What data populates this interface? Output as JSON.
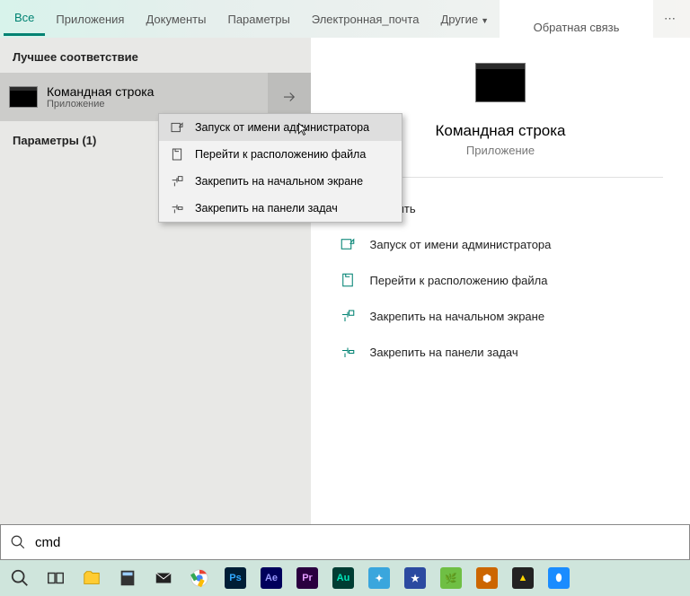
{
  "tabs": {
    "all": "Все",
    "apps": "Приложения",
    "docs": "Документы",
    "settings": "Параметры",
    "email": "Электронная_почта",
    "more": "Другие",
    "feedback": "Обратная связь"
  },
  "left": {
    "best_match": "Лучшее соответствие",
    "result_title": "Командная строка",
    "result_sub": "Приложение",
    "params": "Параметры (1)"
  },
  "context": {
    "run_admin": "Запуск от имени администратора",
    "open_loc": "Перейти к расположению файла",
    "pin_start": "Закрепить на начальном экране",
    "pin_task": "Закрепить на панели задач"
  },
  "preview": {
    "title": "Командная строка",
    "sub": "Приложение",
    "open": "Открыть",
    "run_admin": "Запуск от имени администратора",
    "open_loc": "Перейти к расположению файла",
    "pin_start": "Закрепить на начальном экране",
    "pin_task": "Закрепить на панели задач"
  },
  "search": {
    "query": "cmd"
  },
  "taskbar": {
    "ps": "Ps",
    "ae": "Ae",
    "pr": "Pr",
    "au": "Au"
  }
}
